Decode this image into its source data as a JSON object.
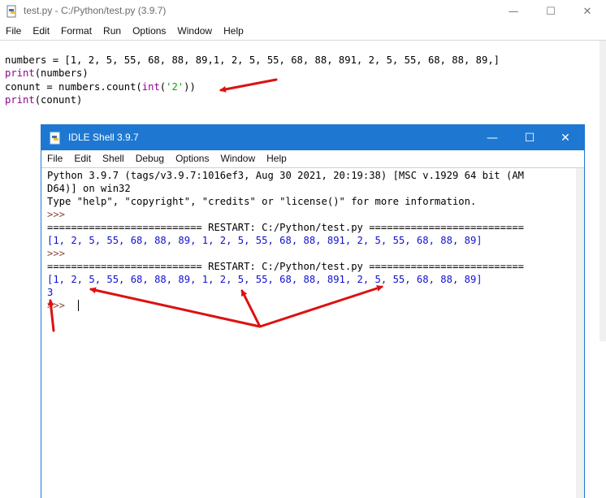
{
  "editor": {
    "title": "test.py - C:/Python/test.py (3.9.7)",
    "menu": [
      "File",
      "Edit",
      "Format",
      "Run",
      "Options",
      "Window",
      "Help"
    ],
    "code": {
      "line1": "numbers = [1, 2, 5, 55, 68, 88, 89,1, 2, 5, 55, 68, 88, 891, 2, 5, 55, 68, 88, 89,]",
      "line2_kw": "print",
      "line2_rest": "(numbers)",
      "line3_pre": "conunt = numbers.count(",
      "line3_kw": "int",
      "line3_open": "(",
      "line3_str": "'2'",
      "line3_post": "))",
      "line4_kw": "print",
      "line4_rest": "(conunt)"
    }
  },
  "shell": {
    "title": "IDLE Shell 3.9.7",
    "menu": [
      "File",
      "Edit",
      "Shell",
      "Debug",
      "Options",
      "Window",
      "Help"
    ],
    "lines": {
      "banner1": "Python 3.9.7 (tags/v3.9.7:1016ef3, Aug 30 2021, 20:19:38) [MSC v.1929 64 bit (AM",
      "banner2": "D64)] on win32",
      "banner3": "Type \"help\", \"copyright\", \"credits\" or \"license()\" for more information.",
      "prompt1": ">>>",
      "restart1": "========================== RESTART: C:/Python/test.py ==========================",
      "output1": "[1, 2, 5, 55, 68, 88, 89, 1, 2, 5, 55, 68, 88, 891, 2, 5, 55, 68, 88, 89]",
      "prompt2": ">>>",
      "restart2": "========================== RESTART: C:/Python/test.py ==========================",
      "output2": "[1, 2, 5, 55, 68, 88, 89, 1, 2, 5, 55, 68, 88, 891, 2, 5, 55, 68, 88, 89]",
      "output3": "3",
      "prompt3": ">>>"
    }
  },
  "colors": {
    "shell_titlebar": "#1e78d2",
    "annotation_arrow": "#dd1111",
    "keyword": "#900090",
    "string": "#00aa00",
    "shell_output": "#1010d0"
  }
}
